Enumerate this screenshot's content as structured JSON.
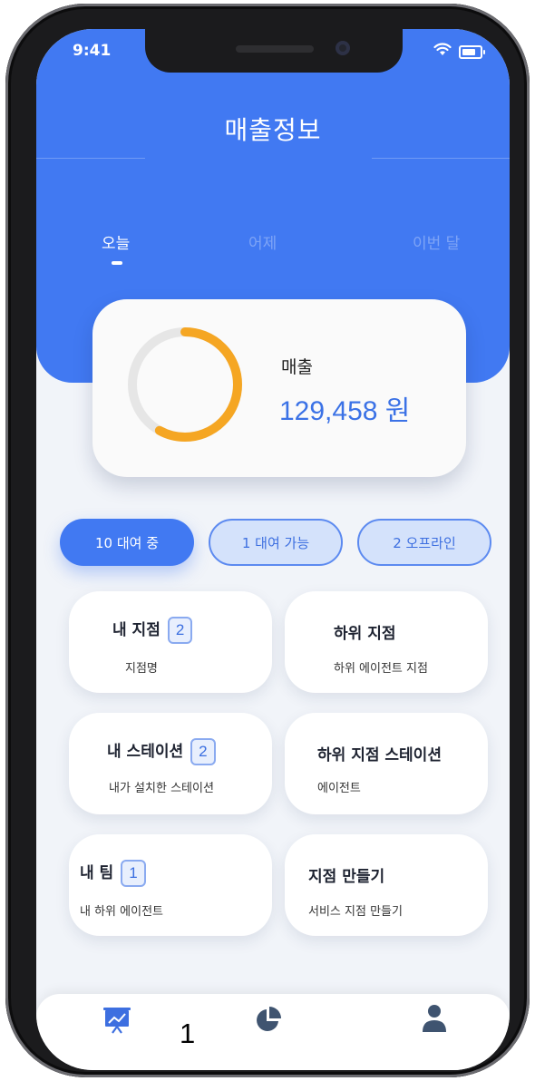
{
  "status_bar": {
    "time": "9:41"
  },
  "header": {
    "title": "매출정보"
  },
  "tabs": [
    {
      "label": "오늘",
      "active": true
    },
    {
      "label": "어제",
      "active": false
    },
    {
      "label": "이번 달",
      "active": false
    }
  ],
  "sales": {
    "label": "매출",
    "value": "129,458 원",
    "progress": 0.58,
    "ring_color": "#f5a623",
    "track_color": "#e6e6e6"
  },
  "chips": [
    {
      "label": "10 대여 중",
      "active": true
    },
    {
      "label": "1 대여 가능",
      "active": false
    },
    {
      "label": "2 오프라인",
      "active": false
    }
  ],
  "tiles": [
    {
      "title": "내 지점",
      "count": "2",
      "subtitle": "지점명"
    },
    {
      "title": "하위 지점",
      "count": null,
      "subtitle": "하위 에이전트 지점"
    },
    {
      "title": "내 스테이션",
      "count": "2",
      "subtitle": "내가 설치한 스테이션"
    },
    {
      "title": "하위 지점 스테이션",
      "count": null,
      "subtitle": "에이전트"
    },
    {
      "title": "내 팀",
      "count": "1",
      "subtitle": "내 하위 에이전트"
    },
    {
      "title": "지점 만들기",
      "count": null,
      "subtitle": "서비스 지점 만들기"
    }
  ],
  "bottom_nav": {
    "items": [
      {
        "icon": "presentation-chart-icon",
        "active": true
      },
      {
        "icon": "pie-chart-icon",
        "active": false
      },
      {
        "icon": "user-icon",
        "active": false
      }
    ],
    "annotation": "1"
  },
  "colors": {
    "primary": "#4179f2",
    "accent": "#f5a623",
    "chip_outline_bg": "#d4e2fb"
  }
}
